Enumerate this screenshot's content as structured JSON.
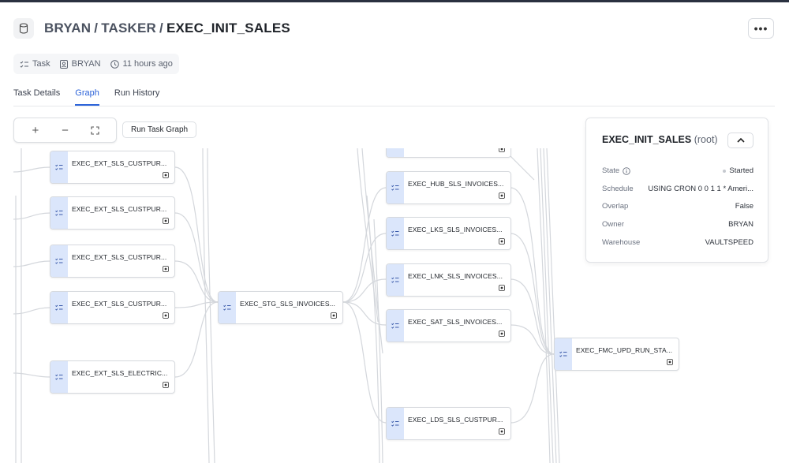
{
  "header": {
    "crumbs": [
      "BRYAN",
      "TASKER"
    ],
    "current": "EXEC_INIT_SALES",
    "more_label": "•••"
  },
  "meta": {
    "type": "Task",
    "owner": "BRYAN",
    "updated": "11 hours ago"
  },
  "tabs": [
    {
      "label": "Task Details"
    },
    {
      "label": "Graph"
    },
    {
      "label": "Run History"
    }
  ],
  "toolbar": {
    "zoom_in": "+",
    "zoom_out": "−",
    "run_label": "Run Task Graph"
  },
  "nodes": [
    {
      "label": "EXEC_EXT_SLS_CUSTPUR..."
    },
    {
      "label": "EXEC_EXT_SLS_CUSTPUR..."
    },
    {
      "label": "EXEC_EXT_SLS_CUSTPUR..."
    },
    {
      "label": "EXEC_EXT_SLS_CUSTPUR..."
    },
    {
      "label": "EXEC_EXT_SLS_ELECTRIC..."
    },
    {
      "label": "EXEC_STG_SLS_INVOICES..."
    },
    {
      "label": ""
    },
    {
      "label": "EXEC_HUB_SLS_INVOICES..."
    },
    {
      "label": "EXEC_LKS_SLS_INVOICES..."
    },
    {
      "label": "EXEC_LNK_SLS_INVOICES..."
    },
    {
      "label": "EXEC_SAT_SLS_INVOICES..."
    },
    {
      "label": "EXEC_LDS_SLS_CUSTPUR..."
    },
    {
      "label": "EXEC_FMC_UPD_RUN_STA..."
    }
  ],
  "panel": {
    "name": "EXEC_INIT_SALES",
    "root_tag": "(root)",
    "rows": [
      {
        "key": "State",
        "value": "Started"
      },
      {
        "key": "Schedule",
        "value": "USING CRON 0 0 1 1 * Ameri..."
      },
      {
        "key": "Overlap",
        "value": "False"
      },
      {
        "key": "Owner",
        "value": "BRYAN"
      },
      {
        "key": "Warehouse",
        "value": "VAULTSPEED"
      }
    ]
  },
  "colors": {
    "accent": "#2c63d9",
    "node_icon_bg": "#dbe6fb",
    "edge": "#d4d7dc"
  }
}
